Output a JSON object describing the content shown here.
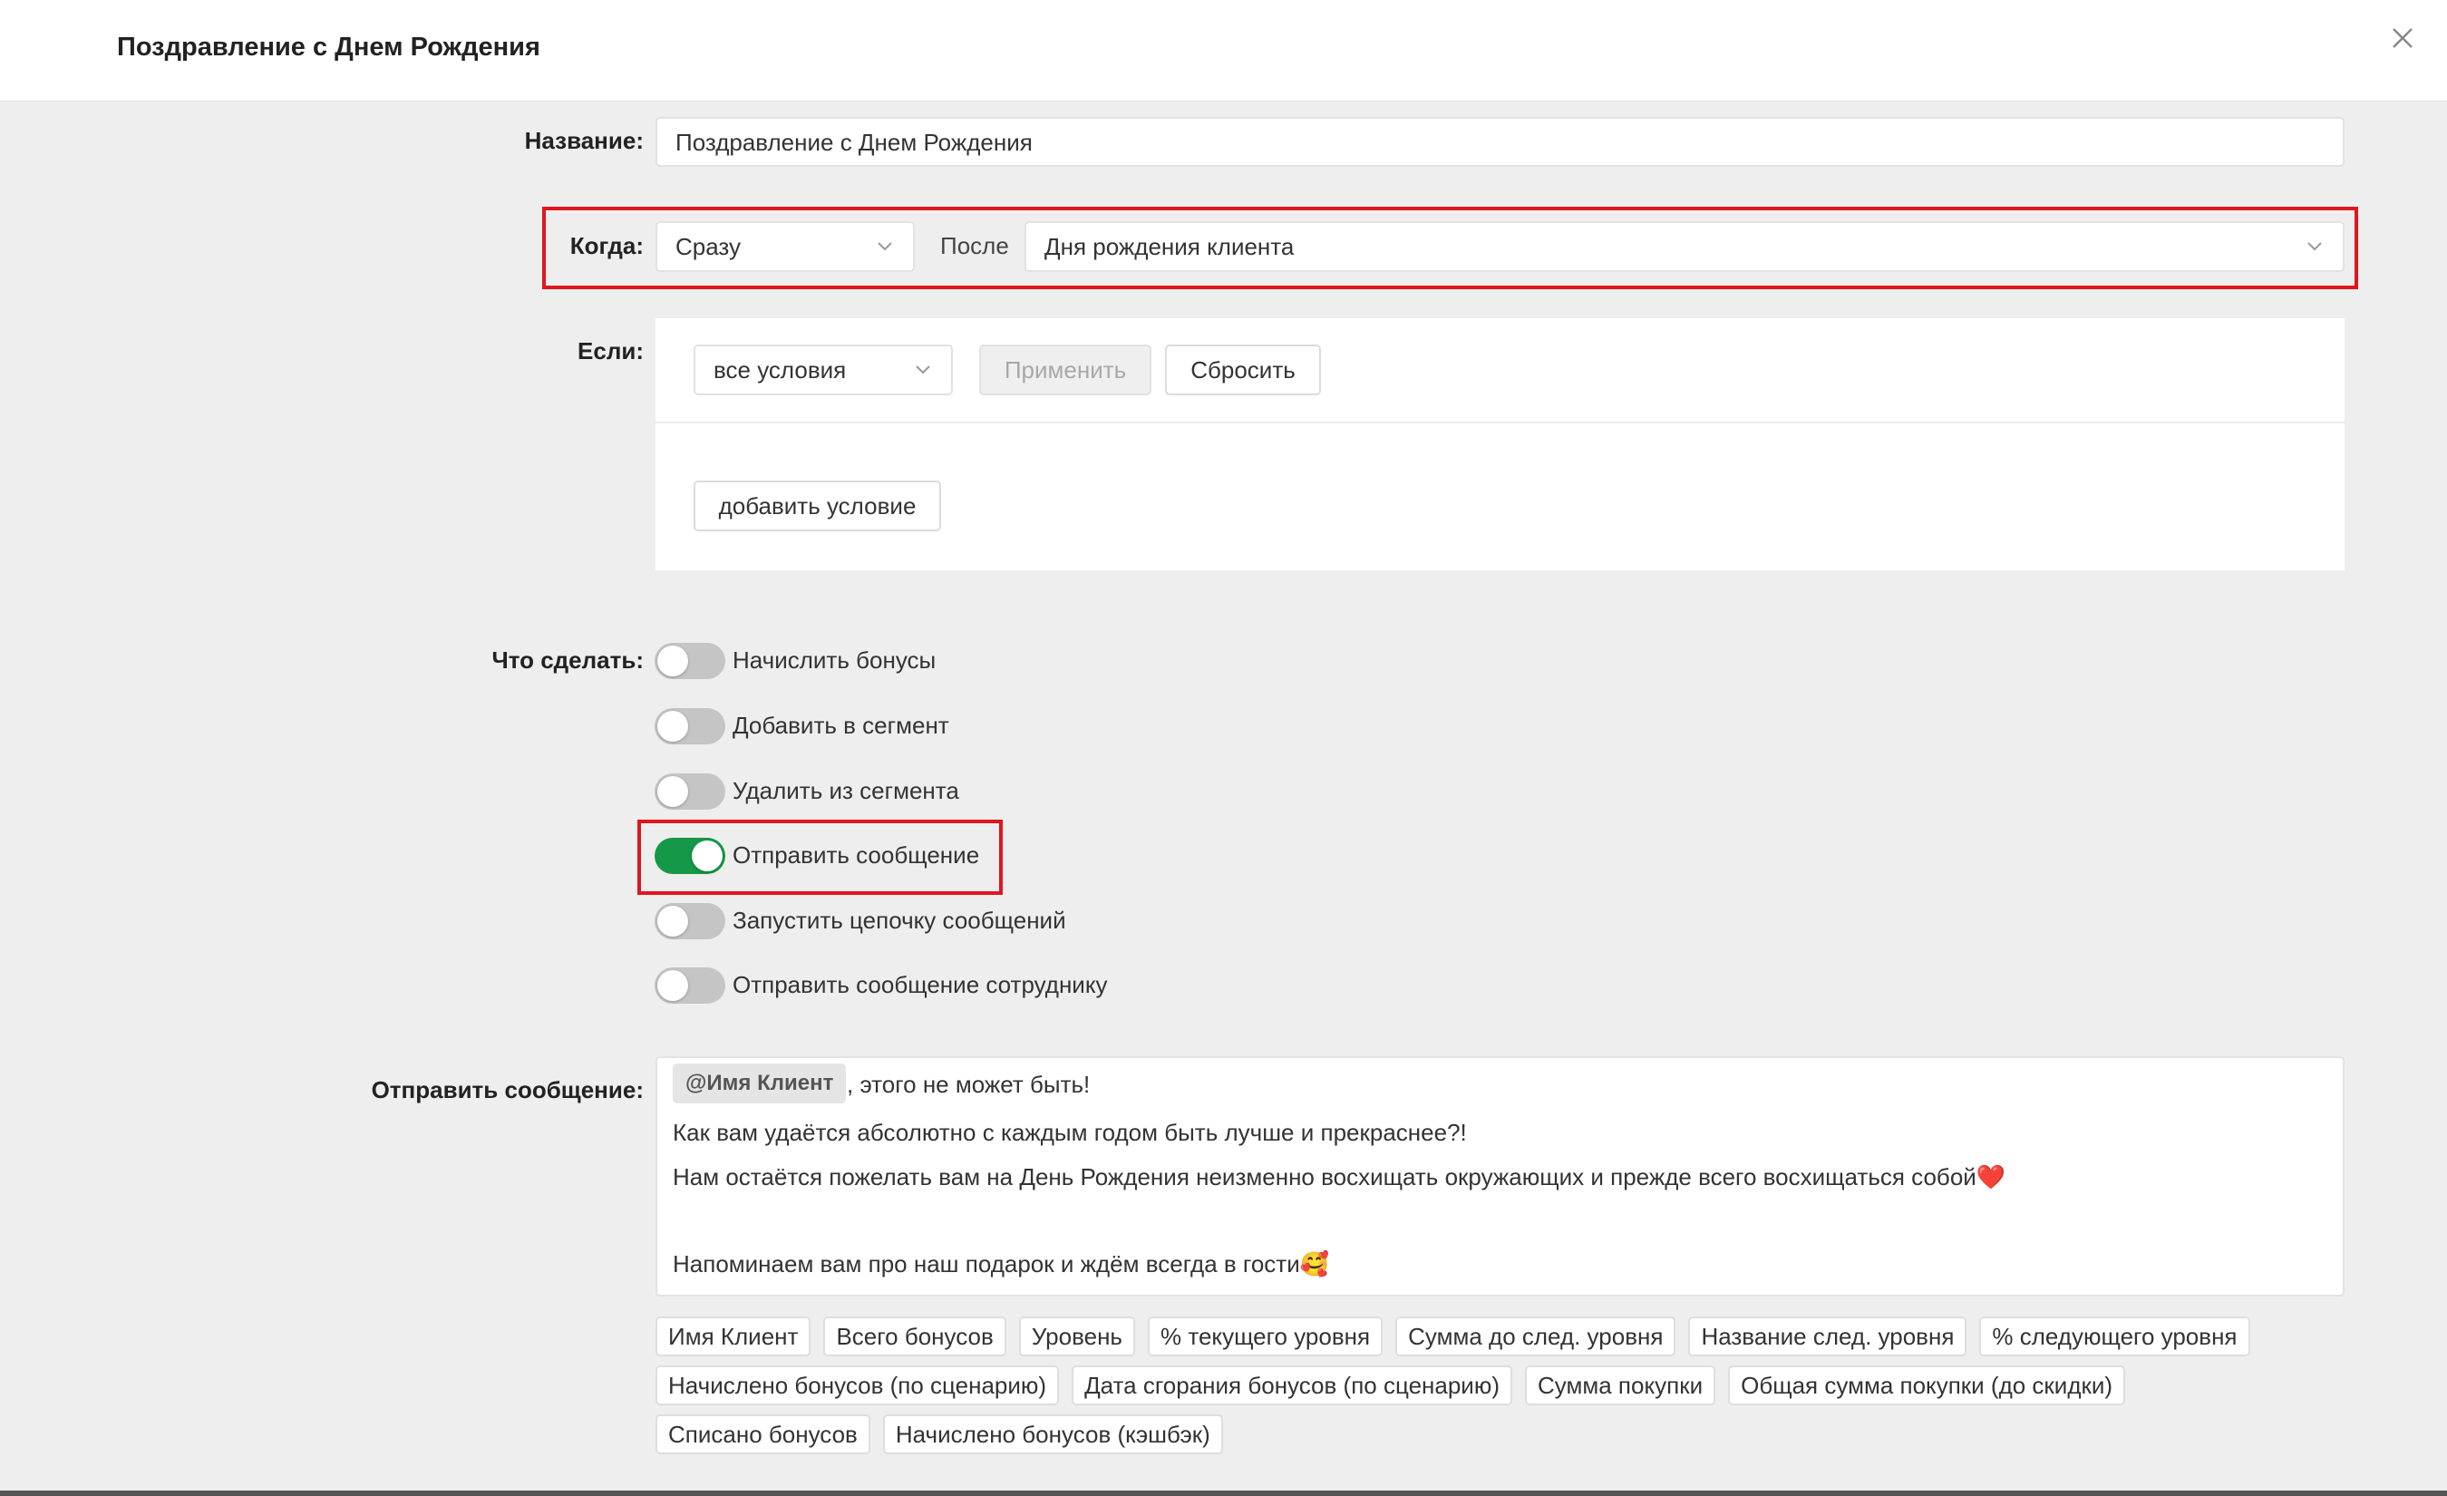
{
  "modal": {
    "title": "Поздравление с Днем Рождения"
  },
  "form": {
    "name": {
      "label": "Название",
      "colon": ":",
      "value": "Поздравление с Днем Рождения"
    },
    "when": {
      "label": "Когда",
      "colon": ":",
      "timing": "Сразу",
      "after_label": "После",
      "event": "Дня рождения клиента"
    },
    "if": {
      "label": "Если",
      "colon": ":",
      "condition_mode": "все условия",
      "apply_button": "Применить",
      "reset_button": "Сбросить",
      "add_condition_button": "добавить условие"
    },
    "actions": {
      "label": "Что сделать",
      "colon": ":",
      "items": [
        {
          "label": "Начислить бонусы",
          "enabled": false
        },
        {
          "label": "Добавить в сегмент",
          "enabled": false
        },
        {
          "label": "Удалить из сегмента",
          "enabled": false
        },
        {
          "label": "Отправить сообщение",
          "enabled": true
        },
        {
          "label": "Запустить цепочку сообщений",
          "enabled": false
        },
        {
          "label": "Отправить сообщение сотруднику",
          "enabled": false
        }
      ]
    },
    "message": {
      "label": "Отправить сообщение",
      "colon": ":",
      "mention": "@Имя Клиент",
      "line1_rest": ", этого не может быть!",
      "line2": "Как вам удаётся абсолютно с каждым годом быть лучше и прекраснее?!",
      "line3": "Нам остаётся пожелать вам на День Рождения неизменно восхищать окружающих и прежде всего восхищаться собой❤️",
      "line4": "Напоминаем вам про наш подарок и ждём всегда в гости🥰"
    },
    "variables": [
      [
        "Имя Клиент",
        "Всего бонусов",
        "Уровень",
        "% текущего уровня",
        "Сумма до след. уровня",
        "Название след. уровня",
        "% следующего уровня"
      ],
      [
        "Начислено бонусов (по сценарию)",
        "Дата сгорания бонусов (по сценарию)",
        "Сумма покупки",
        "Общая сумма покупки (до скидки)"
      ],
      [
        "Списано бонусов",
        "Начислено бонусов (кэшбэк)"
      ]
    ]
  },
  "colors": {
    "accent_green": "#159847",
    "highlight_red": "#e0161e",
    "background": "#eeeeee"
  }
}
